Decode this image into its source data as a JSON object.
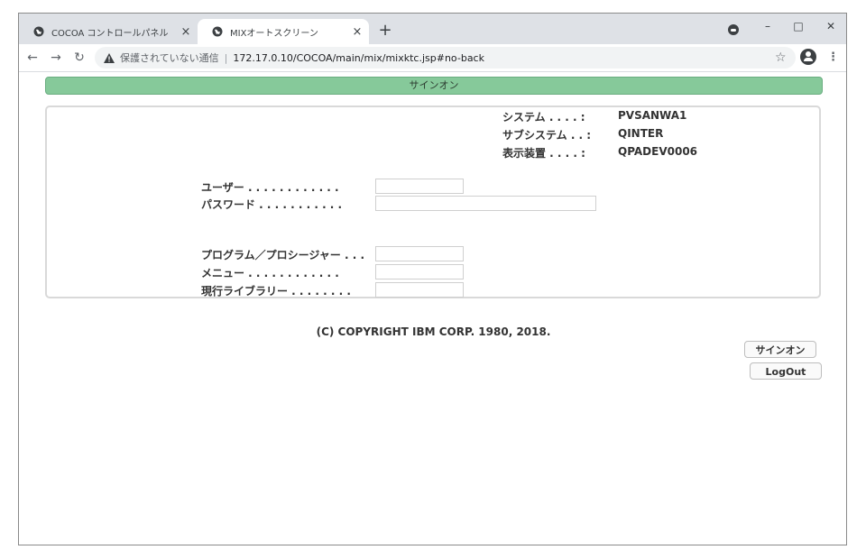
{
  "tabs": [
    {
      "title": "COCOA コントロールパネル",
      "close": "×"
    },
    {
      "title": "MIXオートスクリーン",
      "close": "×"
    }
  ],
  "toolbar": {
    "insecure_label": "保護されていない通信",
    "url": "172.17.0.10/COCOA/main/mix/mixktc.jsp#no-back"
  },
  "banner": {
    "title": "サインオン"
  },
  "system_info": [
    {
      "label": "システム . . . . :",
      "value": "PVSANWA1"
    },
    {
      "label": "サブシステム . . :",
      "value": "QINTER"
    },
    {
      "label": "表示装置 . . . . :",
      "value": "QPADEV0006"
    }
  ],
  "fields": {
    "user": {
      "label": "ユーザー . . . . . . . . . . . .",
      "value": ""
    },
    "password": {
      "label": "パスワード . . . . . . . . . . .",
      "value": ""
    },
    "program": {
      "label": "プログラム／プロシージャー . . .",
      "value": ""
    },
    "menu": {
      "label": "メニュー . . . . . . . . . . . .",
      "value": ""
    },
    "library": {
      "label": "現行ライブラリー . . . . . . . .",
      "value": ""
    }
  },
  "copyright": "(C) COPYRIGHT IBM CORP. 1980, 2018.",
  "buttons": {
    "signon": "サインオン",
    "logout": "LogOut"
  },
  "icons": {
    "tab_favicon": "globe-icon",
    "back": "arrow-left-icon",
    "forward": "arrow-right-icon",
    "reload": "reload-icon",
    "warning": "warning-triangle-icon",
    "bookmark": "star-icon",
    "account": "account-circle-icon",
    "menu": "kebab-menu-icon"
  }
}
